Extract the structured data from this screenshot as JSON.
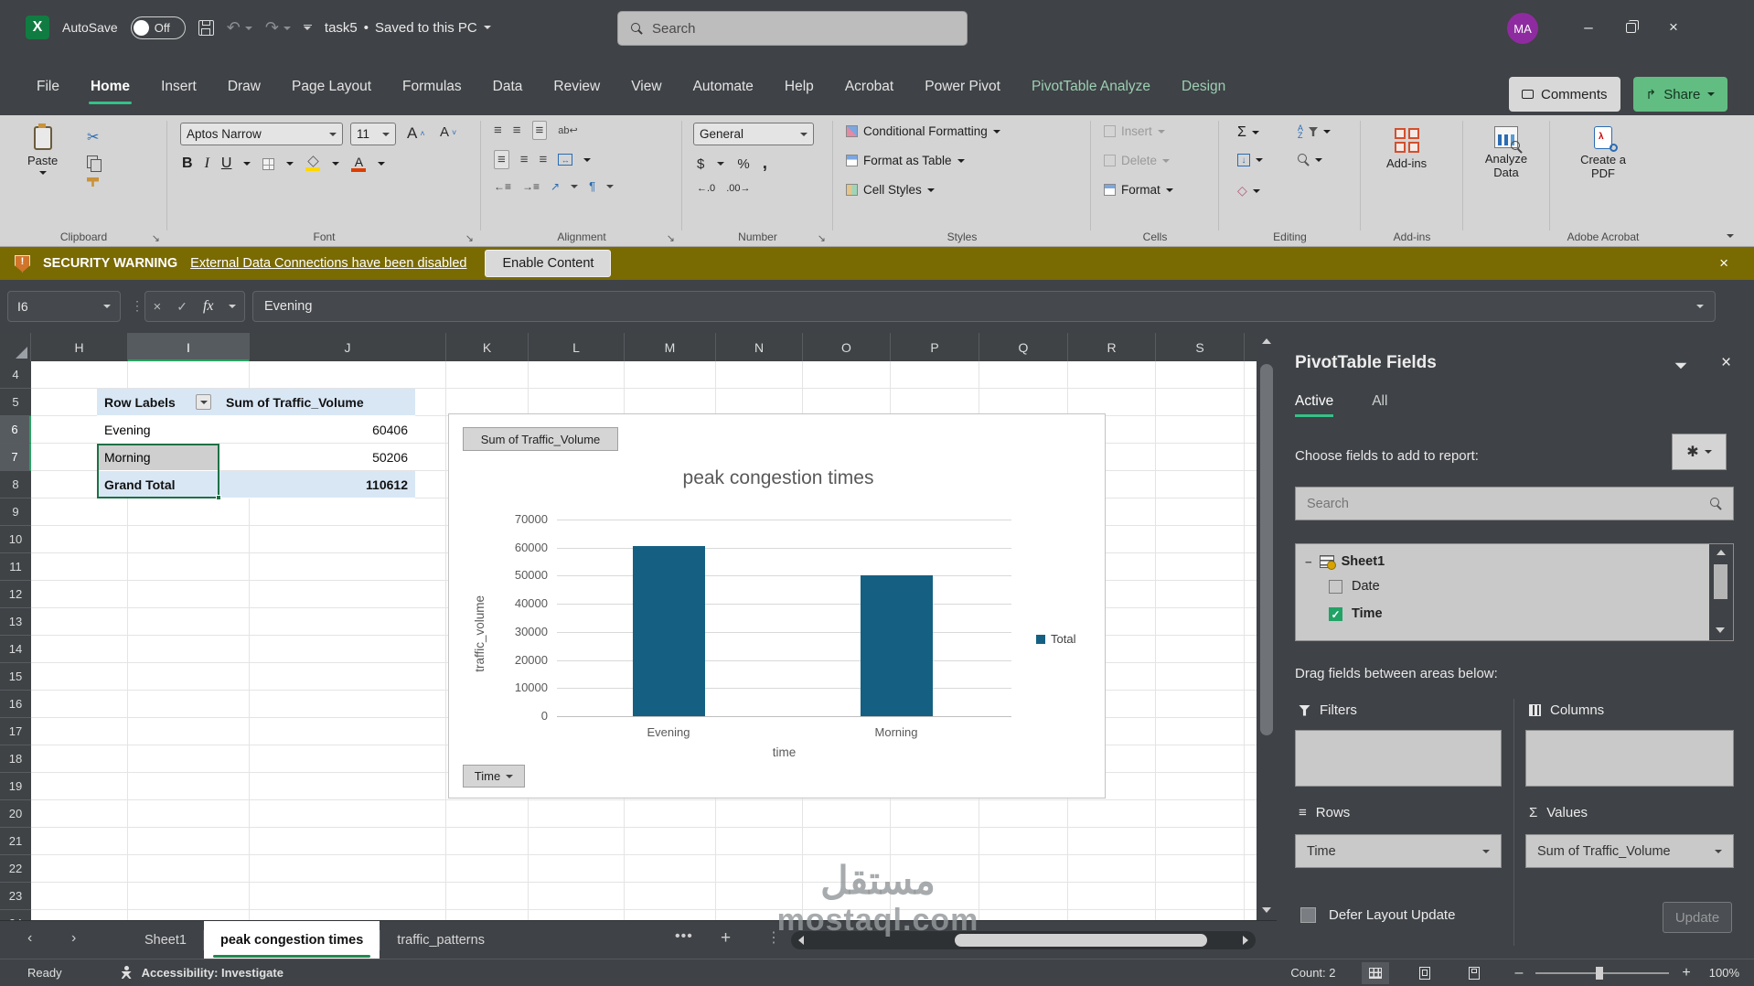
{
  "titlebar": {
    "app_initial": "X",
    "autosave_label": "AutoSave",
    "autosave_state": "Off",
    "doc_title": "task5",
    "doc_separator": "•",
    "doc_status": "Saved to this PC",
    "search_placeholder": "Search",
    "avatar_initials": "MA"
  },
  "menu": {
    "tabs": [
      {
        "label": "File",
        "active": false,
        "contextual": false
      },
      {
        "label": "Home",
        "active": true,
        "contextual": false
      },
      {
        "label": "Insert",
        "active": false,
        "contextual": false
      },
      {
        "label": "Draw",
        "active": false,
        "contextual": false
      },
      {
        "label": "Page Layout",
        "active": false,
        "contextual": false
      },
      {
        "label": "Formulas",
        "active": false,
        "contextual": false
      },
      {
        "label": "Data",
        "active": false,
        "contextual": false
      },
      {
        "label": "Review",
        "active": false,
        "contextual": false
      },
      {
        "label": "View",
        "active": false,
        "contextual": false
      },
      {
        "label": "Automate",
        "active": false,
        "contextual": false
      },
      {
        "label": "Help",
        "active": false,
        "contextual": false
      },
      {
        "label": "Acrobat",
        "active": false,
        "contextual": false
      },
      {
        "label": "Power Pivot",
        "active": false,
        "contextual": false
      },
      {
        "label": "PivotTable Analyze",
        "active": false,
        "contextual": true
      },
      {
        "label": "Design",
        "active": false,
        "contextual": true
      }
    ],
    "comments_label": "Comments",
    "share_label": "Share"
  },
  "ribbon": {
    "paste_label": "Paste",
    "font_name": "Aptos Narrow",
    "font_size": "11",
    "bold": "B",
    "italic": "I",
    "underline": "U",
    "number_format": "General",
    "currency": "$",
    "percent": "%",
    "comma": ",",
    "inc_decimal": "←.0",
    "dec_decimal": ".00→",
    "conditional_formatting": "Conditional Formatting",
    "format_as_table": "Format as Table",
    "cell_styles": "Cell Styles",
    "insert_label": "Insert",
    "delete_label": "Delete",
    "format_label": "Format",
    "sigma": "Σ",
    "addins_label": "Add-ins",
    "analyze_data_label": "Analyze Data",
    "create_pdf_label": "Create a PDF",
    "group_labels": {
      "clipboard": "Clipboard",
      "font": "Font",
      "alignment": "Alignment",
      "number": "Number",
      "styles": "Styles",
      "cells": "Cells",
      "editing": "Editing",
      "addins": "Add-ins",
      "acrobat": "Adobe Acrobat"
    }
  },
  "security": {
    "label": "SECURITY WARNING",
    "message": "External Data Connections have been disabled",
    "action": "Enable Content"
  },
  "formula_bar": {
    "cell_ref": "I6",
    "fx": "fx",
    "value": "Evening"
  },
  "grid": {
    "columns": [
      "H",
      "I",
      "J",
      "K",
      "L",
      "M",
      "N",
      "O",
      "P",
      "Q",
      "R",
      "S"
    ],
    "row_start": 4,
    "row_end": 24,
    "selected_column": "I",
    "selected_rows": [
      6,
      7
    ]
  },
  "pivot": {
    "header": [
      "Row Labels",
      "Sum of Traffic_Volume"
    ],
    "rows": [
      {
        "label": "Evening",
        "value": "60406"
      },
      {
        "label": "Morning",
        "value": "50206"
      }
    ],
    "total": {
      "label": "Grand Total",
      "value": "110612"
    }
  },
  "chart_data": {
    "type": "bar",
    "title": "peak congestion times",
    "categories": [
      "Evening",
      "Morning"
    ],
    "series": [
      {
        "name": "Total",
        "values": [
          60406,
          50206
        ]
      }
    ],
    "values": [
      60406,
      50206
    ],
    "xlabel": "time",
    "ylabel": "traffic_volume",
    "ylim": [
      0,
      70000
    ],
    "ytick_step": 10000,
    "grid": true,
    "legend": [
      "Total"
    ],
    "legend_position": "right",
    "bar_color": "#156082",
    "value_field_button": "Sum of Traffic_Volume",
    "axis_field_button": "Time"
  },
  "fields_pane": {
    "title": "PivotTable Fields",
    "tabs": [
      {
        "label": "Active",
        "active": true
      },
      {
        "label": "All",
        "active": false
      }
    ],
    "choose_label": "Choose fields to add to report:",
    "search_placeholder": "Search",
    "source_table": "Sheet1",
    "fields": [
      {
        "name": "Date",
        "checked": false
      },
      {
        "name": "Time",
        "checked": true
      }
    ],
    "drag_label": "Drag fields between areas below:",
    "areas": {
      "filters": "Filters",
      "columns": "Columns",
      "rows": "Rows",
      "values": "Values"
    },
    "rows_items": [
      "Time"
    ],
    "values_items": [
      "Sum of Traffic_Volume"
    ],
    "defer_label": "Defer Layout Update",
    "update_label": "Update"
  },
  "sheet_bar": {
    "tabs": [
      {
        "label": "Sheet1",
        "active": false
      },
      {
        "label": "peak congestion times",
        "active": true
      },
      {
        "label": "traffic_patterns",
        "active": false
      }
    ]
  },
  "status_bar": {
    "ready": "Ready",
    "accessibility": "Accessibility: Investigate",
    "count": "Count: 2",
    "zoom": "100%"
  },
  "watermark": {
    "line1": "مستقل",
    "line2": "mostaql.com"
  }
}
